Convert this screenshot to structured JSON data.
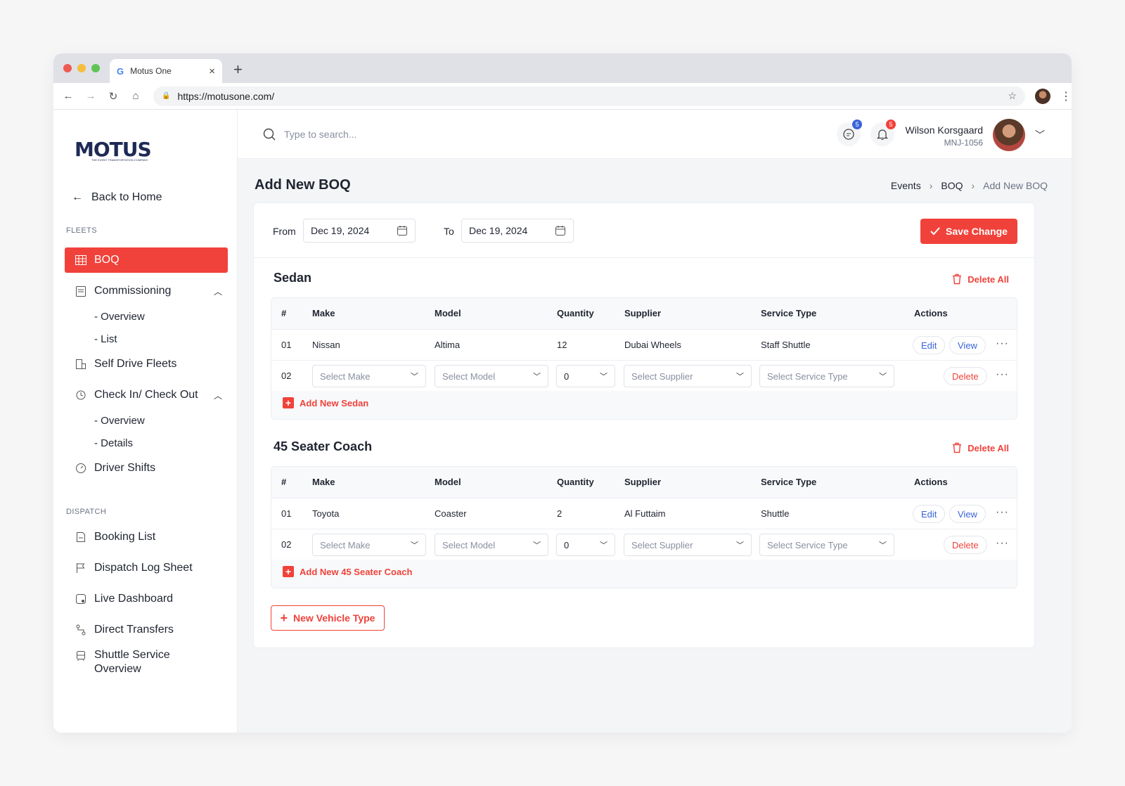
{
  "browser": {
    "tab_title": "Motus One",
    "favicon": "G",
    "close": "×",
    "new_tab": "+",
    "url": "https://motusone.com/",
    "traffic_colors": [
      "#ee5a52",
      "#f5be3c",
      "#5fc454"
    ]
  },
  "sidebar": {
    "logo": "MOTUS",
    "logo_tagline": "THE EVENT TRANSPORTATION COMPANY",
    "back": "Back to Home",
    "sections": {
      "fleets": "FLEETS",
      "dispatch": "DISPATCH"
    },
    "items": [
      {
        "label": "BOQ",
        "icon": "grid-icon",
        "active": true
      },
      {
        "label": "Commissioning",
        "icon": "clipboard-icon",
        "expanded": true
      },
      {
        "label": "Self Drive Fleets",
        "icon": "building-icon"
      },
      {
        "label": "Check In/ Check Out",
        "icon": "clock-icon",
        "expanded": true
      },
      {
        "label": "Driver Shifts",
        "icon": "gauge-icon"
      },
      {
        "label": "Booking List",
        "icon": "file-icon"
      },
      {
        "label": "Dispatch Log Sheet",
        "icon": "flag-icon"
      },
      {
        "label": "Live Dashboard",
        "icon": "monitor-icon"
      },
      {
        "label": "Direct Transfers",
        "icon": "route-icon"
      },
      {
        "label": "Shuttle Service",
        "label2": "Overview",
        "icon": "bus-icon"
      }
    ],
    "sub_items": {
      "commissioning": [
        "- Overview",
        "- List"
      ],
      "checkin": [
        "- Overview",
        "- Details"
      ]
    }
  },
  "topbar": {
    "search_placeholder": "Type to search...",
    "messages_badge": "5",
    "notifications_badge": "5",
    "user_name": "Wilson Korsgaard",
    "user_id": "MNJ-1056",
    "badge_colors": {
      "messages": "#3a64d8",
      "notifications": "#f0423a"
    }
  },
  "page": {
    "title": "Add New BOQ",
    "breadcrumb": [
      "Events",
      "BOQ",
      "Add New BOQ"
    ]
  },
  "form": {
    "from_label": "From",
    "from_date": "Dec 19, 2024",
    "to_label": "To",
    "to_date": "Dec 19, 2024",
    "save_label": "Save Change"
  },
  "columns": [
    "#",
    "Make",
    "Model",
    "Quantity",
    "Supplier",
    "Service Type",
    "Actions"
  ],
  "placeholders": {
    "make": "Select Make",
    "model": "Select Model",
    "quantity": "0",
    "supplier": "Select Supplier",
    "service_type": "Select Service Type"
  },
  "actions": {
    "edit": "Edit",
    "view": "View",
    "delete": "Delete",
    "more": "···"
  },
  "vehicle_types": [
    {
      "title": "Sedan",
      "delete_all": "Delete All",
      "row1": {
        "num": "01",
        "make": "Nissan",
        "model": "Altima",
        "quantity": "12",
        "supplier": "Dubai Wheels",
        "service_type": "Staff Shuttle"
      },
      "row2_num": "02",
      "add_label": "Add New Sedan"
    },
    {
      "title": "45 Seater Coach",
      "delete_all": "Delete All",
      "row1": {
        "num": "01",
        "make": "Toyota",
        "model": "Coaster",
        "quantity": "2",
        "supplier": "Al Futtaim",
        "service_type": "Shuttle"
      },
      "row2_num": "02",
      "add_label": "Add New 45 Seater Coach"
    }
  ],
  "new_vehicle_type": "New Vehicle Type",
  "colors": {
    "accent": "#f0423a",
    "link_blue": "#3a64d8",
    "navy": "#1e2a55"
  }
}
